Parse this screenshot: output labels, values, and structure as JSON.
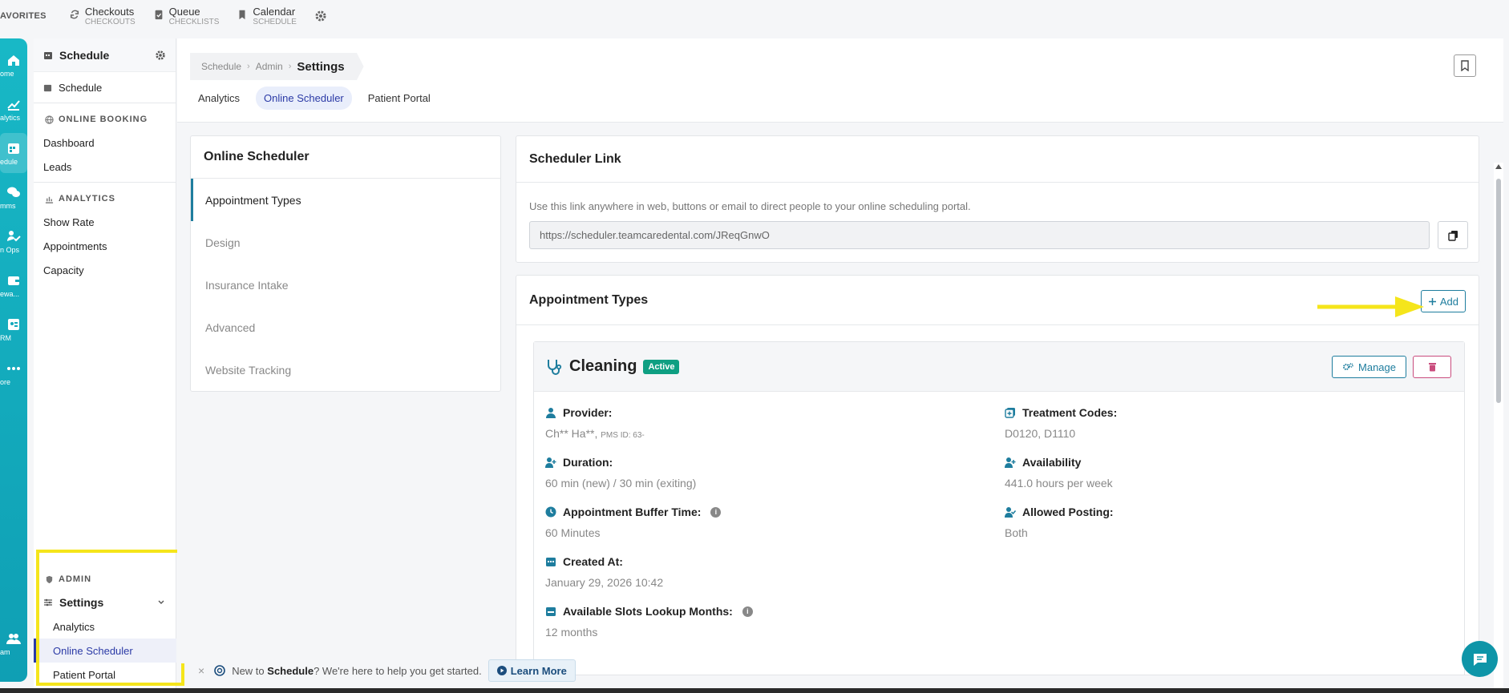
{
  "favorites": {
    "label": "AVORITES",
    "items": [
      {
        "title": "Checkouts",
        "sub": "CHECKOUTS"
      },
      {
        "title": "Queue",
        "sub": "CHECKLISTS"
      },
      {
        "title": "Calendar",
        "sub": "SCHEDULE"
      }
    ]
  },
  "rail": [
    {
      "label": "ome",
      "icon": "home-icon"
    },
    {
      "label": "alytics",
      "icon": "chart-icon"
    },
    {
      "label": "edule",
      "icon": "calendar-icon"
    },
    {
      "label": "mms",
      "icon": "chat-icon"
    },
    {
      "label": "n Ops",
      "icon": "ops-icon"
    },
    {
      "label": "ewa...",
      "icon": "wallet-icon"
    },
    {
      "label": "RM",
      "icon": "crm-icon"
    },
    {
      "label": "ore",
      "icon": "more-icon"
    },
    {
      "label": "am",
      "icon": "team-icon"
    }
  ],
  "sidebar": {
    "title": "Schedule",
    "schedule_item": "Schedule",
    "sections": [
      {
        "title": "ONLINE BOOKING",
        "items": [
          "Dashboard",
          "Leads"
        ]
      },
      {
        "title": "ANALYTICS",
        "items": [
          "Show Rate",
          "Appointments",
          "Capacity"
        ]
      }
    ],
    "admin": {
      "title": "ADMIN",
      "group": "Settings",
      "items": [
        "Analytics",
        "Online Scheduler",
        "Patient Portal"
      ]
    }
  },
  "breadcrumb": {
    "c1": "Schedule",
    "c2": "Admin",
    "current": "Settings"
  },
  "tabs": [
    "Analytics",
    "Online Scheduler",
    "Patient Portal"
  ],
  "menu": {
    "title": "Online Scheduler",
    "items": [
      "Appointment Types",
      "Design",
      "Insurance Intake",
      "Advanced",
      "Website Tracking"
    ]
  },
  "scheduler_link": {
    "title": "Scheduler Link",
    "description": "Use this link anywhere in web, buttons or email to direct people to your online scheduling portal.",
    "url": "https://scheduler.teamcaredental.com/JReqGnwO"
  },
  "appointment_types": {
    "title": "Appointment Types",
    "add_label": "Add",
    "card": {
      "name": "Cleaning",
      "status": "Active",
      "manage_label": "Manage",
      "provider_label": "Provider:",
      "provider_value": "Ch** Ha**,",
      "provider_pms": "PMS ID: 63-",
      "duration_label": "Duration:",
      "duration_value": "60 min (new) / 30 min (exiting)",
      "buffer_label": "Appointment Buffer Time:",
      "buffer_value": "60 Minutes",
      "created_label": "Created At:",
      "created_value": "January 29, 2026 10:42",
      "lookup_label": "Available Slots Lookup Months:",
      "lookup_value": "12 months",
      "codes_label": "Treatment Codes:",
      "codes_value": "D0120, D1110",
      "availability_label": "Availability",
      "availability_value": "441.0 hours per week",
      "posting_label": "Allowed Posting:",
      "posting_value": "Both"
    }
  },
  "help": {
    "pre": "New to",
    "bold": "Schedule",
    "post": "? We're here to help you get started.",
    "learn_more": "Learn More"
  },
  "colors": {
    "accent": "#1e7d9e",
    "highlight": "#f5e51b",
    "active_badge": "#0e9f82"
  }
}
